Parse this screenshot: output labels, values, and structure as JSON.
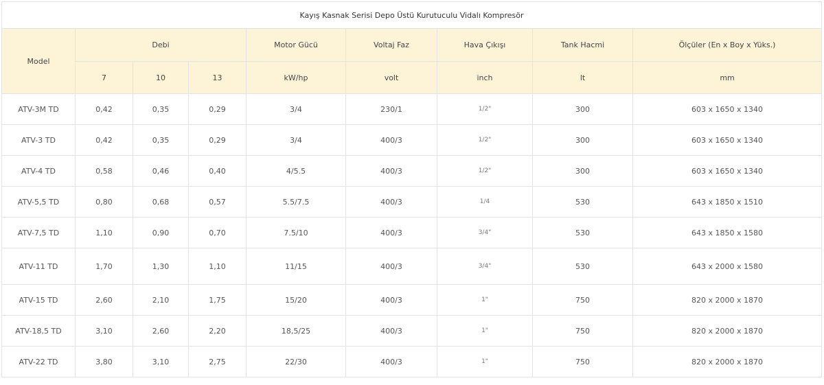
{
  "title": "Kayış Kasnak Serisi Depo Üstü Kurutuculu Vidalı Kompresör",
  "headers": {
    "model": "Model",
    "debi": "Debi",
    "motor": "Motor Gücü",
    "voltaj": "Voltaj Faz",
    "hava": "Hava Çıkışı",
    "tank": "Tank Hacmi",
    "olculer": "Ölçüler (En x Boy x Yüks.)"
  },
  "subheaders": {
    "debi_7": "7",
    "debi_10": "10",
    "debi_13": "13",
    "motor": "kW/hp",
    "voltaj": "volt",
    "hava": "inch",
    "tank": "lt",
    "olculer": "mm"
  },
  "rows": [
    {
      "model": "ATV-3M TD",
      "d7": "0,42",
      "d10": "0,35",
      "d13": "0,29",
      "motor": "3/4",
      "voltaj": "230/1",
      "hava": "1/2\"",
      "tank": "300",
      "olculer": "603 x 1650 x 1340"
    },
    {
      "model": "ATV-3 TD",
      "d7": "0,42",
      "d10": "0,35",
      "d13": "0,29",
      "motor": "3/4",
      "voltaj": "400/3",
      "hava": "1/2\"",
      "tank": "300",
      "olculer": "603 x 1650 x 1340"
    },
    {
      "model": "ATV-4 TD",
      "d7": "0,58",
      "d10": "0,46",
      "d13": "0,40",
      "motor": "4/5.5",
      "voltaj": "400/3",
      "hava": "1/2\"",
      "tank": "300",
      "olculer": "603 x 1650 x 1340"
    },
    {
      "model": "ATV-5,5 TD",
      "d7": "0,80",
      "d10": "0,68",
      "d13": "0,57",
      "motor": "5.5/7.5",
      "voltaj": "400/3",
      "hava": "1/4",
      "tank": "530",
      "olculer": "643 x 1850 x 1510"
    },
    {
      "model": "ATV-7,5 TD",
      "d7": "1,10",
      "d10": "0,90",
      "d13": "0,70",
      "motor": "7.5/10",
      "voltaj": "400/3",
      "hava": "3/4\"",
      "tank": "530",
      "olculer": "643 x 1850 x 1580"
    },
    {
      "model": "ATV-11 TD",
      "d7": "1,70",
      "d10": "1,30",
      "d13": "1,10",
      "motor": "11/15",
      "voltaj": "400/3",
      "hava": "3/4\"",
      "tank": "530",
      "olculer": "643 x 2000 x 1580"
    },
    {
      "model": "ATV-15 TD",
      "d7": "2,60",
      "d10": "2,10",
      "d13": "1,75",
      "motor": "15/20",
      "voltaj": "400/3",
      "hava": "1\"",
      "tank": "750",
      "olculer": "820 x 2000 x 1870"
    },
    {
      "model": "ATV-18,5 TD",
      "d7": "3,10",
      "d10": "2,60",
      "d13": "2,20",
      "motor": "18,5/25",
      "voltaj": "400/3",
      "hava": "1\"",
      "tank": "750",
      "olculer": "820 x 2000 x 1870"
    },
    {
      "model": "ATV-22 TD",
      "d7": "3,80",
      "d10": "3,10",
      "d13": "2,75",
      "motor": "22/30",
      "voltaj": "400/3",
      "hava": "1\"",
      "tank": "750",
      "olculer": "820 x 2000 x 1870"
    }
  ]
}
